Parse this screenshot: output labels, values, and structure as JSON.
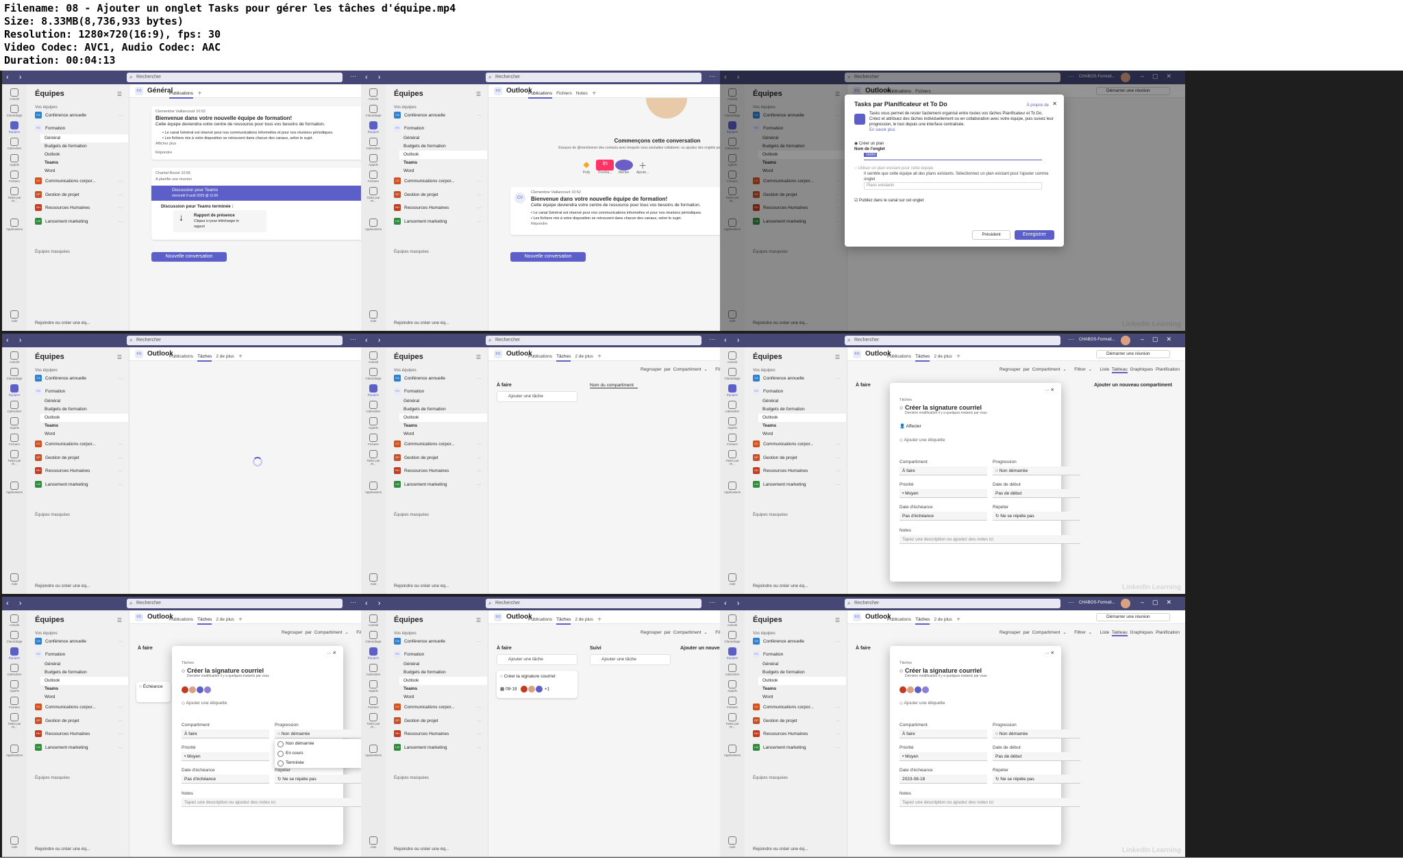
{
  "header": {
    "filename": "Filename: 08 - Ajouter un onglet Tasks pour gérer les tâches d'équipe.mp4",
    "size": "Size: 8.33MB(8,736,933 bytes)",
    "resolution": "Resolution: 1280×720(16:9), fps: 30",
    "codec": "Video Codec: AVC1, Audio Codec: AAC",
    "duration": "Duration: 00:04:13"
  },
  "app": {
    "search": "Rechercher",
    "org": "CHABOS-Formati...",
    "teams_title": "Équipes",
    "your_teams": "Vos équipes",
    "hidden": "Équipes masquées",
    "join": "Rejoindre ou créer une éq...",
    "meet": "Démarrer une réunion",
    "watermark": "LinkedIn Learning"
  },
  "rail": [
    "Activité",
    "Clavardage",
    "Équipes",
    "Calendrier",
    "Appels",
    "Fichiers",
    "Tasks par Pl...",
    "Applications",
    "Aide"
  ],
  "teams": {
    "conf": "Conférence annuelle",
    "formation": "Formation",
    "comm": "Communications corpor...",
    "gestion": "Gestion de projet",
    "rh": "Ressources Humaines",
    "lancement": "Lancement marketing"
  },
  "channels": {
    "general": "Général",
    "budgets": "Budgets de formation",
    "outlook": "Outlook",
    "teams": "Teams",
    "word": "Word"
  },
  "t1": {
    "channel": "Général",
    "tab": "Publications",
    "author": "Clementine Vaillancourt",
    "time": "10:52",
    "welcome": "Bienvenue dans votre nouvelle équipe de formation!",
    "intro": "Cette équipe deviendra votre centre de ressource pour tous vos besoins de formation.",
    "b1": "Le canal Général est réservé pour nos communications informelles et pour nos réunions périodiques.",
    "b2": "Les fichiers mis à votre disposition se retrouvent dans chacun des canaux, selon le sujet.",
    "more": "Afficher plus",
    "reply": "Répondre",
    "author2": "Chantal Bossé",
    "time2": "10:56",
    "planned": "A planifié une réunion",
    "meeting": "Discussion pour Teams",
    "meeting_date": "mercredi 9 août 2023 @ 11:00",
    "ended": "Discussion pour Teams terminée :",
    "report": "Rapport de présence",
    "report_sub": "Cliquez ici pour télécharger le rapport",
    "newconv": "Nouvelle conversation"
  },
  "t2": {
    "channel": "Outlook",
    "tabs": [
      "Publications",
      "Fichiers",
      "Notes"
    ],
    "start": "Commençons cette conversation",
    "start_sub": "Essayez de @mentionner des contacts avec lesquels vous souhaitez collaborer, ou ajoutez des onglets pour personnaliser votre e",
    "apps": [
      "Polly",
      "Freeha...",
      "Mentor",
      "Ajoute..."
    ],
    "avatar": "CV"
  },
  "t3": {
    "title": "Tasks par Planificateur et To Do",
    "about": "À propos de",
    "desc": "Tasks vous permet de rester facilement organisé entre toutes vos tâches Planificateur et To Do. Créez et attribuez des tâches individuellement ou en collaboration avec votre équipe, puis suivez leur progression, le tout depuis une interface centralisée.",
    "learn": "En savoir plus",
    "create": "Créer un plan",
    "tabname_label": "Nom de l'onglet",
    "tabname": "Tasks",
    "existing": "Utiliser un plan existant pour cette équipe",
    "existing_sub": "Il semble que cette équipe ait des plans existants. Sélectionnez un plan existant pour l'ajouter comme onglet",
    "plans": "Plans existants",
    "publish": "Publiez dans le canal sur cet onglet",
    "prev": "Précédent",
    "save": "Enregistrer"
  },
  "board": {
    "taches": "Tâches",
    "more": "2 de plus",
    "group": "Regrouper par Compartiment",
    "filter": "Filtrer",
    "views": [
      "Liste",
      "Tableau",
      "Graphiques",
      "Planification"
    ],
    "afaire": "À faire",
    "add": "Ajouter une tâche",
    "bucket_name": "Nom du compartiment",
    "new_bucket": "Ajouter un nouveau compartiment",
    "suivi": "Suivi"
  },
  "task": {
    "crumb": "Tâches",
    "title": "Créer la signature courriel",
    "modified": "Dernière modification il y a quelques instants par vous",
    "assign": "Affecter",
    "label": "Ajouter une étiquette",
    "bucket_l": "Compartiment",
    "bucket": "À faire",
    "progress_l": "Progression",
    "progress": "Non démarrée",
    "priority_l": "Priorité",
    "priority": "Moyen",
    "start_l": "Date de début",
    "start": "Pas de début",
    "due_l": "Date d'échéance",
    "due": "Pas d'échéance",
    "due_set": "2023-08-18",
    "repeat_l": "Répéter",
    "repeat": "Ne se répète pas",
    "notes_l": "Notes",
    "notes": "Tapez une description ou ajoutez des notes ici",
    "card_date": "08-18",
    "card_plus": "+1",
    "echeance": "Échéance",
    "dd": [
      "Non démarrée",
      "En cours",
      "Terminée"
    ]
  }
}
